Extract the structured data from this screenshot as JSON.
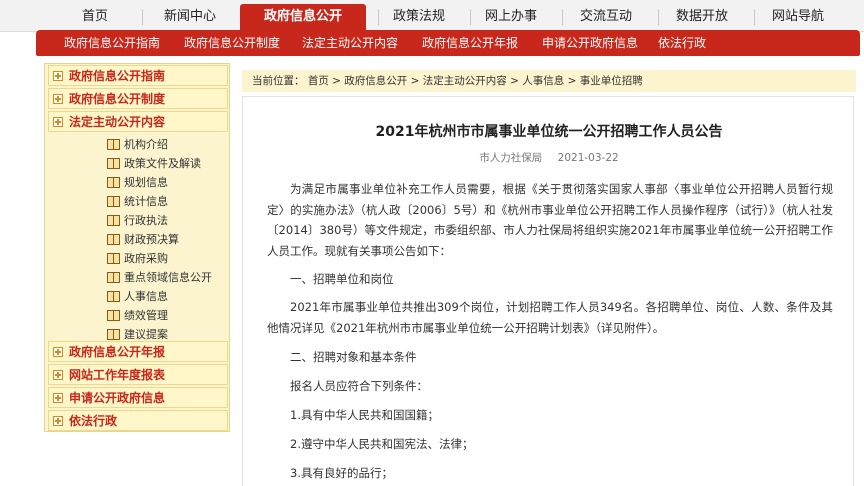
{
  "topnav": {
    "items": [
      {
        "label": "首页",
        "active": false
      },
      {
        "label": "新闻中心",
        "active": false
      },
      {
        "label": "政府信息公开",
        "active": true
      },
      {
        "label": "政策法规",
        "active": false
      },
      {
        "label": "网上办事",
        "active": false
      },
      {
        "label": "交流互动",
        "active": false
      },
      {
        "label": "数据开放",
        "active": false
      },
      {
        "label": "网站导航",
        "active": false
      }
    ],
    "active_color": "#c8271b"
  },
  "subnav": {
    "items": [
      "政府信息公开指南",
      "政府信息公开制度",
      "法定主动公开内容",
      "政府信息公开年报",
      "申请公开政府信息",
      "依法行政"
    ]
  },
  "sidebar": {
    "top_items": [
      "政府信息公开指南",
      "政府信息公开制度",
      "法定主动公开内容"
    ],
    "sub_items": [
      "机构介绍",
      "政策文件及解读",
      "规划信息",
      "统计信息",
      "行政执法",
      "财政预决算",
      "政府采购",
      "重点领域信息公开",
      "人事信息",
      "绩效管理",
      "建议提案"
    ],
    "bottom_items": [
      "政府信息公开年报",
      "网站工作年度报表",
      "申请公开政府信息",
      "依法行政"
    ]
  },
  "breadcrumb": {
    "text": "当前位置：  首页 > 政府信息公开 > 法定主动公开内容 > 人事信息 > 事业单位招聘"
  },
  "article": {
    "title": "2021年杭州市市属事业单位统一公开招聘工作人员公告",
    "source": "市人力社保局",
    "date": "2021-03-22",
    "paragraphs": [
      "为满足市属事业单位补充工作人员需要，根据《关于贯彻落实国家人事部〈事业单位公开招聘人员暂行规定〉的实施办法》（杭人政〔2006〕5号）和《杭州市事业单位公开招聘工作人员操作程序（试行）》（杭人社发〔2014〕380号）等文件规定，市委组织部、市人力社保局将组织实施2021年市属事业单位统一公开招聘工作人员工作。现就有关事项公告如下：",
      "一、招聘单位和岗位",
      "2021年市属事业单位共推出309个岗位，计划招聘工作人员349名。各招聘单位、岗位、人数、条件及其他情况详见《2021年杭州市市属事业单位统一公开招聘计划表》（详见附件）。",
      "二、招聘对象和基本条件",
      "报名人员应符合下列条件：",
      "1.具有中华人民共和国国籍；",
      "2.遵守中华人民共和国宪法、法律；",
      "3.具有良好的品行；"
    ]
  }
}
